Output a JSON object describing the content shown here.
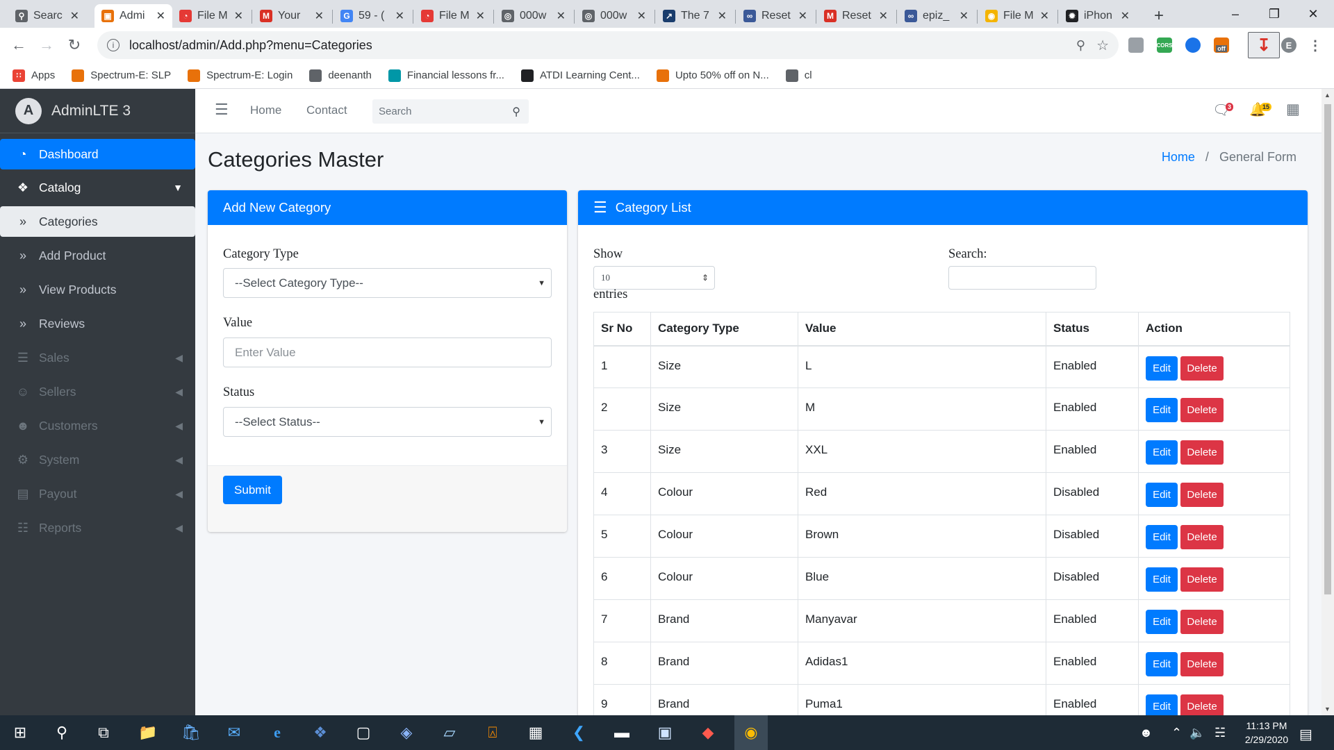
{
  "browser": {
    "tabs": [
      {
        "title": "Searc",
        "color": "#5f6368",
        "glyph": "search-icon"
      },
      {
        "title": "Admi",
        "color": "#e8710a",
        "glyph": "codeigniter-icon"
      },
      {
        "title": "File M",
        "color": "#e53935",
        "glyph": "filezilla-icon"
      },
      {
        "title": "Your",
        "color": "#d93025",
        "glyph": "gmail-icon"
      },
      {
        "title": "59 - (",
        "color": "#4285f4",
        "glyph": "google-icon"
      },
      {
        "title": "File M",
        "color": "#e53935",
        "glyph": "filezilla-icon"
      },
      {
        "title": "000w",
        "color": "#5f6368",
        "glyph": "globe-icon"
      },
      {
        "title": "000w",
        "color": "#5f6368",
        "glyph": "globe-icon"
      },
      {
        "title": "The 7",
        "color": "#1a3d6d",
        "glyph": "chart-icon"
      },
      {
        "title": "Reset",
        "color": "#3b5998",
        "glyph": "infinity-icon"
      },
      {
        "title": "Reset",
        "color": "#d93025",
        "glyph": "gmail-icon"
      },
      {
        "title": "epiz_",
        "color": "#3b5998",
        "glyph": "infinity-icon"
      },
      {
        "title": "File M",
        "color": "#f4b400",
        "glyph": "bulb-icon"
      },
      {
        "title": "iPhon",
        "color": "#202124",
        "glyph": "aperture-icon"
      }
    ],
    "url": "localhost/admin/Add.php?menu=Categories",
    "ext_off_label": "off",
    "ext_cors_label": "CORS",
    "profile_initial": "E",
    "bookmarks": [
      {
        "label": "Apps",
        "color": "#ea4335"
      },
      {
        "label": "Spectrum-E: SLP",
        "color": "#e8710a"
      },
      {
        "label": "Spectrum-E: Login",
        "color": "#e8710a"
      },
      {
        "label": "deenanth",
        "color": "#5f6368"
      },
      {
        "label": "Financial lessons fr...",
        "color": "#0097a7"
      },
      {
        "label": "ATDI Learning Cent...",
        "color": "#202124"
      },
      {
        "label": "Upto 50% off on N...",
        "color": "#e8710a"
      },
      {
        "label": "cl",
        "color": "#5f6368"
      }
    ]
  },
  "sidebar": {
    "brand": "AdminLTE 3",
    "items": [
      {
        "label": "Dashboard"
      },
      {
        "label": "Catalog"
      },
      {
        "label": "Categories"
      },
      {
        "label": "Add Product"
      },
      {
        "label": "View Products"
      },
      {
        "label": "Reviews"
      },
      {
        "label": "Sales"
      },
      {
        "label": "Sellers"
      },
      {
        "label": "Customers"
      },
      {
        "label": "System"
      },
      {
        "label": "Payout"
      },
      {
        "label": "Reports"
      }
    ]
  },
  "topnav": {
    "home": "Home",
    "contact": "Contact",
    "search_placeholder": "Search",
    "messages_badge": "3",
    "notifications_badge": "15"
  },
  "content": {
    "title": "Categories Master",
    "breadcrumb": {
      "home": "Home",
      "sep": "/",
      "current": "General Form"
    }
  },
  "form": {
    "header": "Add New Category",
    "category_type_label": "Category Type",
    "category_type_value": "--Select Category Type--",
    "value_label": "Value",
    "value_placeholder": "Enter Value",
    "status_label": "Status",
    "status_value": "--Select Status--",
    "submit": "Submit"
  },
  "list": {
    "header": "Category List",
    "show_label": "Show",
    "page_size": "10",
    "entries_label": "entries",
    "search_label": "Search:",
    "columns": [
      "Sr No",
      "Category Type",
      "Value",
      "Status",
      "Action"
    ],
    "edit_label": "Edit",
    "delete_label": "Delete",
    "rows": [
      {
        "sr": "1",
        "type": "Size",
        "value": "L",
        "status": "Enabled"
      },
      {
        "sr": "2",
        "type": "Size",
        "value": "M",
        "status": "Enabled"
      },
      {
        "sr": "3",
        "type": "Size",
        "value": "XXL",
        "status": "Enabled"
      },
      {
        "sr": "4",
        "type": "Colour",
        "value": "Red",
        "status": "Disabled"
      },
      {
        "sr": "5",
        "type": "Colour",
        "value": "Brown",
        "status": "Disabled"
      },
      {
        "sr": "6",
        "type": "Colour",
        "value": "Blue",
        "status": "Disabled"
      },
      {
        "sr": "7",
        "type": "Brand",
        "value": "Manyavar",
        "status": "Enabled"
      },
      {
        "sr": "8",
        "type": "Brand",
        "value": "Adidas1",
        "status": "Enabled"
      },
      {
        "sr": "9",
        "type": "Brand",
        "value": "Puma1",
        "status": "Enabled"
      }
    ]
  },
  "taskbar": {
    "time": "11:13 PM",
    "date": "2/29/2020"
  }
}
